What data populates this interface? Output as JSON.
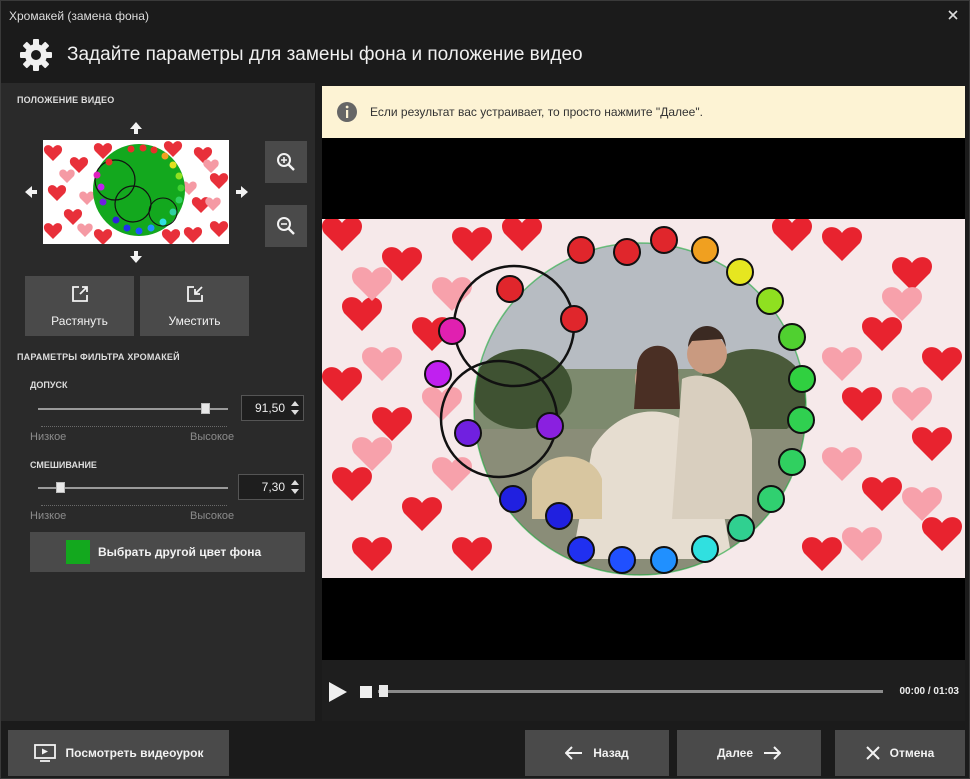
{
  "window": {
    "title": "Хромакей (замена фона)",
    "header_title": "Задайте параметры для замены фона и положение видео"
  },
  "left_panel": {
    "position_label": "ПОЛОЖЕНИЕ ВИДЕО",
    "stretch_label": "Растянуть",
    "fit_label": "Уместить",
    "filter_label": "ПАРАМЕТРЫ ФИЛЬТРА ХРОМАКЕЙ",
    "tolerance": {
      "label": "ДОПУСК",
      "value": "91,50",
      "fraction": 0.9,
      "low": "Низкое",
      "high": "Высокое"
    },
    "blend": {
      "label": "СМЕШИВАНИЕ",
      "value": "7,30",
      "fraction": 0.1,
      "low": "Низкое",
      "high": "Высокое"
    },
    "color_button_label": "Выбрать другой цвет фона",
    "key_color": "#13a81e"
  },
  "notice": {
    "text": "Если результат вас устраивает, то просто нажмите \"Далее\"."
  },
  "player": {
    "time": "00:00 / 01:03",
    "progress": 0.0
  },
  "footer": {
    "tutorial_label": "Посмотреть видеоурок",
    "back_label": "Назад",
    "next_label": "Далее",
    "cancel_label": "Отмена"
  }
}
